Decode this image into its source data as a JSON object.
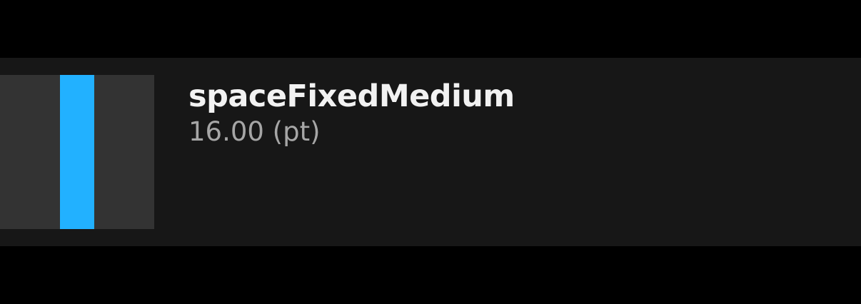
{
  "token": {
    "name": "spaceFixedMedium",
    "value": "16.00 (pt)"
  },
  "colors": {
    "background": "#000000",
    "row_background": "#171717",
    "swatch_background": "#333333",
    "accent": "#22b1ff",
    "name_text": "#f2f2f2",
    "value_text": "#a6a6a6"
  }
}
